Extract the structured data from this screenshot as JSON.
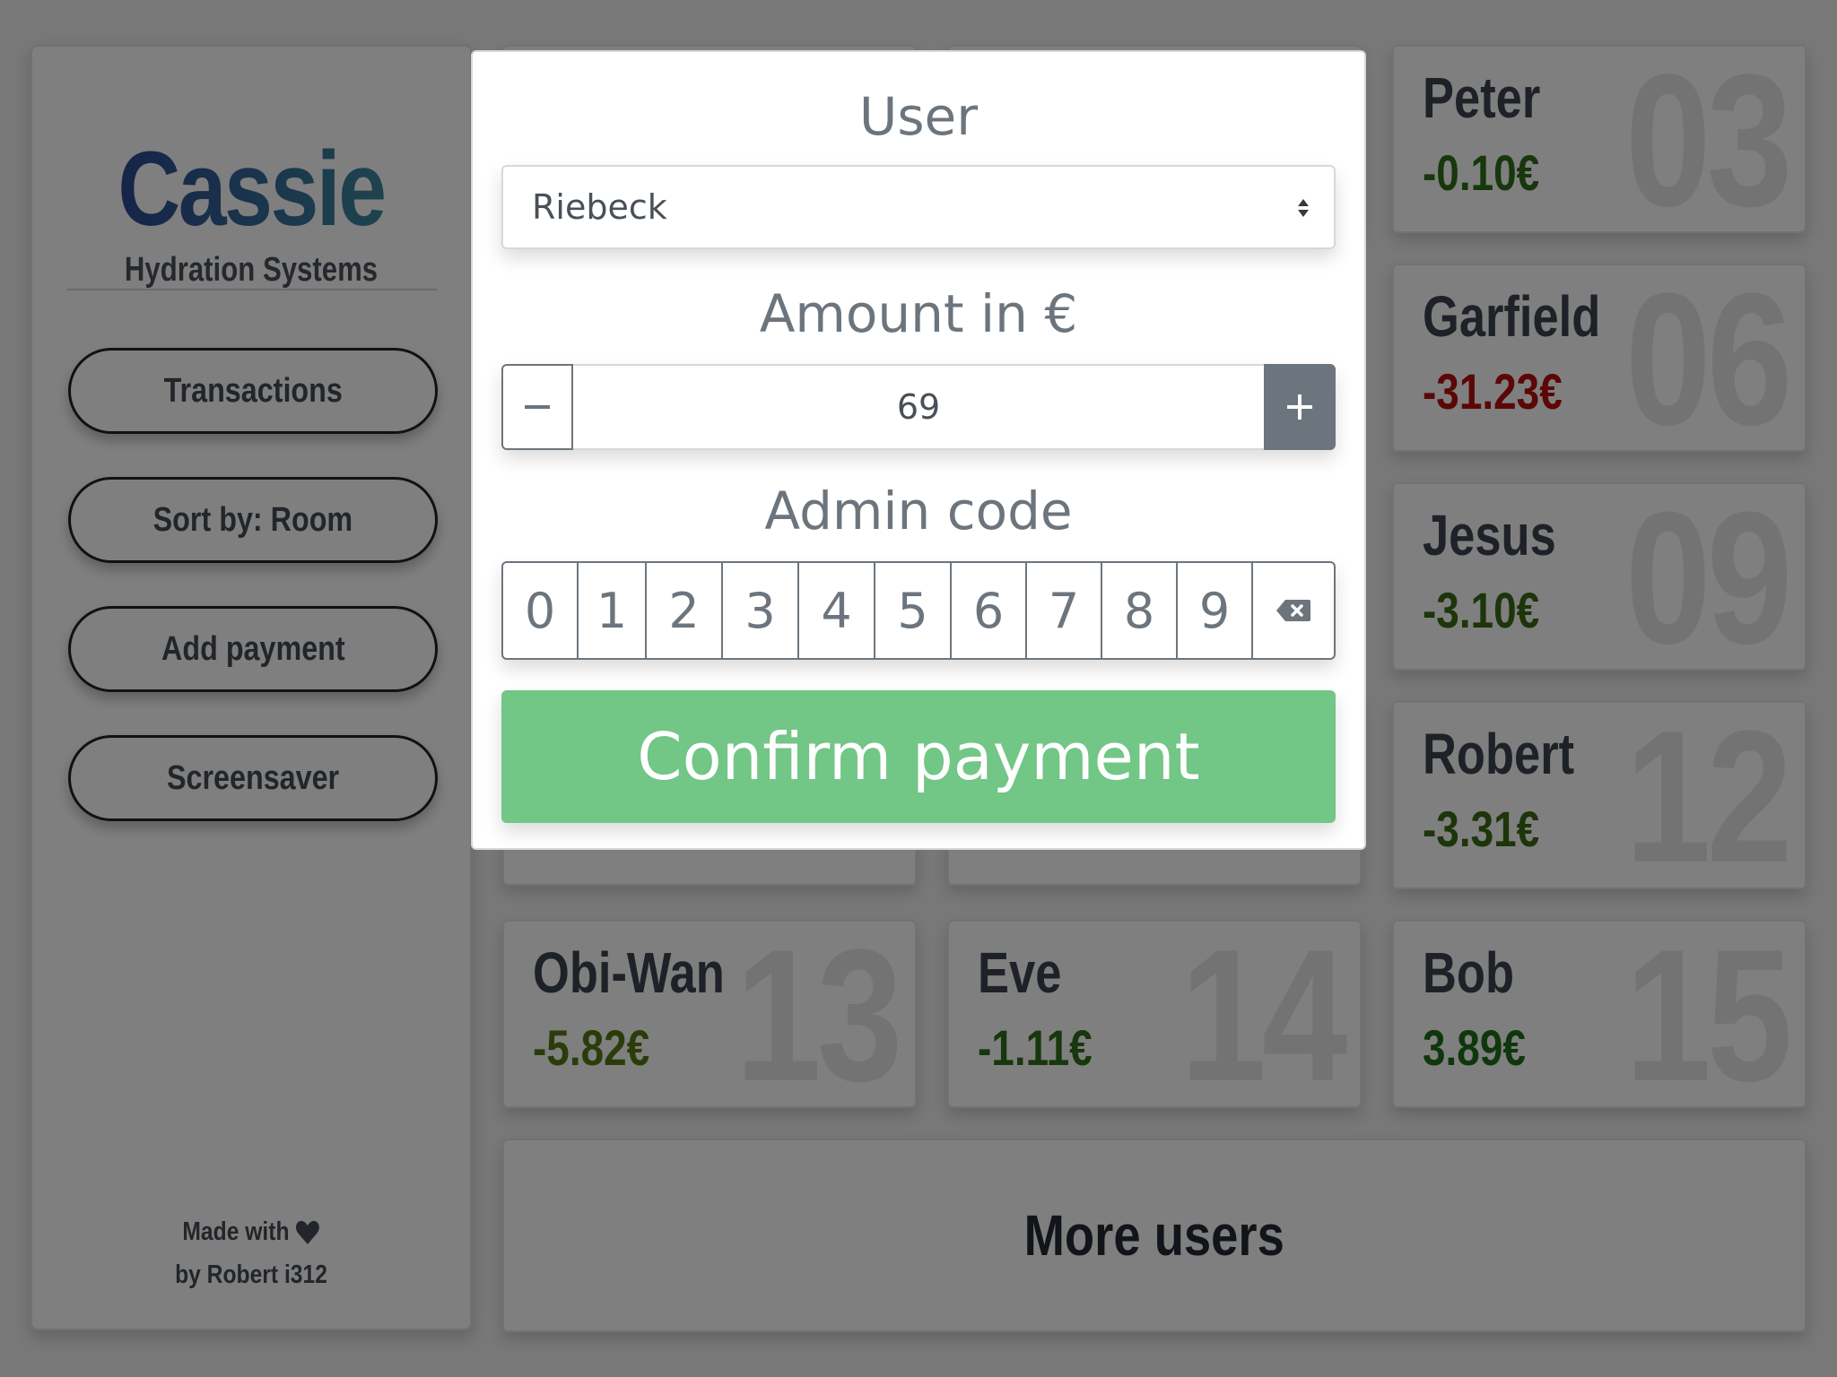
{
  "sidebar": {
    "brand_name": "Cassie",
    "brand_subtitle": "Hydration Systems",
    "buttons": {
      "transactions": "Transactions",
      "sort": "Sort by: Room",
      "add_payment": "Add payment",
      "screensaver": "Screensaver"
    },
    "footer": {
      "made_with": "Made with",
      "author": "by Robert i312"
    }
  },
  "users": [
    {
      "name": "Peter",
      "balance": "-0.10€",
      "room": "03",
      "color": "#2e6e1a"
    },
    {
      "name": "Garfield",
      "balance": "-31.23€",
      "room": "06",
      "color": "#b80f0f"
    },
    {
      "name": "Jesus",
      "balance": "-3.10€",
      "room": "09",
      "color": "#3b6a14"
    },
    {
      "name": "Robert",
      "balance": "-3.31€",
      "room": "12",
      "color": "#3b6a14"
    },
    {
      "name": "Obi-Wan",
      "balance": "-5.82€",
      "room": "13",
      "color": "#577914"
    },
    {
      "name": "Eve",
      "balance": "-1.11€",
      "room": "14",
      "color": "#2e6e1a"
    },
    {
      "name": "Bob",
      "balance": "3.89€",
      "room": "15",
      "color": "#1f6e1a"
    }
  ],
  "more_users": "More users",
  "modal": {
    "user_label": "User",
    "user_selected": "Riebeck",
    "amount_label": "Amount in €",
    "amount_value": "69",
    "admin_label": "Admin code",
    "keys": [
      "0",
      "1",
      "2",
      "3",
      "4",
      "5",
      "6",
      "7",
      "8",
      "9"
    ],
    "confirm_label": "Confirm payment"
  },
  "colors": {
    "confirm_green": "#72c686",
    "secondary_gray": "#6c757d",
    "brand_start": "#2a3d8f",
    "brand_end": "#3f93a2"
  }
}
